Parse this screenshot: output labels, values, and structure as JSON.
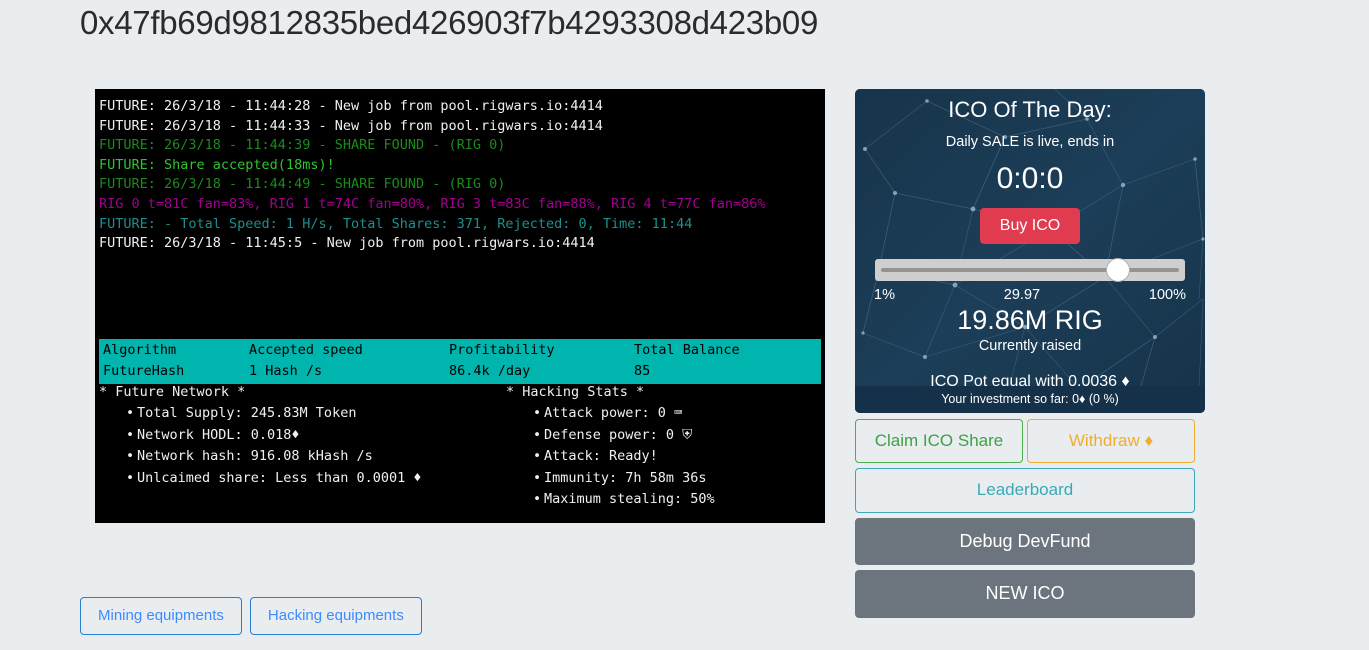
{
  "wallet": {
    "address": "0x47fb69d9812835bed426903f7b4293308d423b09"
  },
  "terminal": {
    "lines": [
      {
        "text": "FUTURE: 26/3/18 - 11:44:28 - New job from pool.rigwars.io:4414",
        "color": "white"
      },
      {
        "text": "FUTURE: 26/3/18 - 11:44:33 - New job from pool.rigwars.io:4414",
        "color": "white"
      },
      {
        "text": "FUTURE: 26/3/18 - 11:44:39 - SHARE FOUND - (RIG 0)",
        "color": "green"
      },
      {
        "text": "FUTURE: Share accepted(18ms)!",
        "color": "lgreen"
      },
      {
        "text": "FUTURE: 26/3/18 - 11:44:49 - SHARE FOUND - (RIG 0)",
        "color": "green"
      },
      {
        "text": "RIG 0 t=81C fan=83%, RIG 1 t=74C fan=80%, RIG 3 t=83C fan=88%, RIG 4 t=77C fan=86%",
        "color": "purple"
      },
      {
        "text": "FUTURE: - Total Speed: 1 H/s, Total Shares: 371, Rejected: 0, Time: 11:44",
        "color": "teal"
      },
      {
        "text": "FUTURE: 26/3/18 - 11:45:5 - New job from pool.rigwars.io:4414",
        "color": "white"
      }
    ]
  },
  "stats_table": {
    "headers": [
      "Algorithm",
      "Accepted speed",
      "Profitability",
      "Total Balance"
    ],
    "row": [
      "FutureHash",
      "1 Hash /s",
      "86.4k /day",
      "85"
    ]
  },
  "future_network": {
    "title": "* Future Network *",
    "items": [
      "Total Supply: 245.83M Token",
      "Network HODL: 0.018♦",
      "Network hash: 916.08 kHash /s",
      "Unlcaimed share: Less than 0.0001 ♦"
    ]
  },
  "hacking_stats": {
    "title": "* Hacking Stats *",
    "items": [
      "Attack power: 0 ⌨",
      "Defense power: 0 ⛨",
      "Attack: Ready!",
      "Immunity: 7h 58m 36s",
      "Maximum stealing: 50%"
    ]
  },
  "bottom_buttons": {
    "mining": "Mining equipments",
    "hacking": "Hacking equipments"
  },
  "ico": {
    "title": "ICO Of The Day:",
    "subtitle": "Daily SALE is live, ends in",
    "countdown": "0:0:0",
    "buy_label": "Buy ICO",
    "slider_min": "1%",
    "slider_value": "29.97",
    "slider_max": "100%",
    "raised_amount": "19.86M RIG",
    "raised_label": "Currently raised",
    "pot": "ICO Pot equal with 0.0036 ♦",
    "investment": "Your investment so far: 0♦ (0 %)",
    "accent_red": "#e03b4e",
    "panel_bg": "#1b3a54"
  },
  "side_buttons": {
    "claim": "Claim ICO Share",
    "withdraw": "Withdraw ♦",
    "leaderboard": "Leaderboard",
    "debug": "Debug DevFund",
    "new_ico": "NEW ICO"
  }
}
